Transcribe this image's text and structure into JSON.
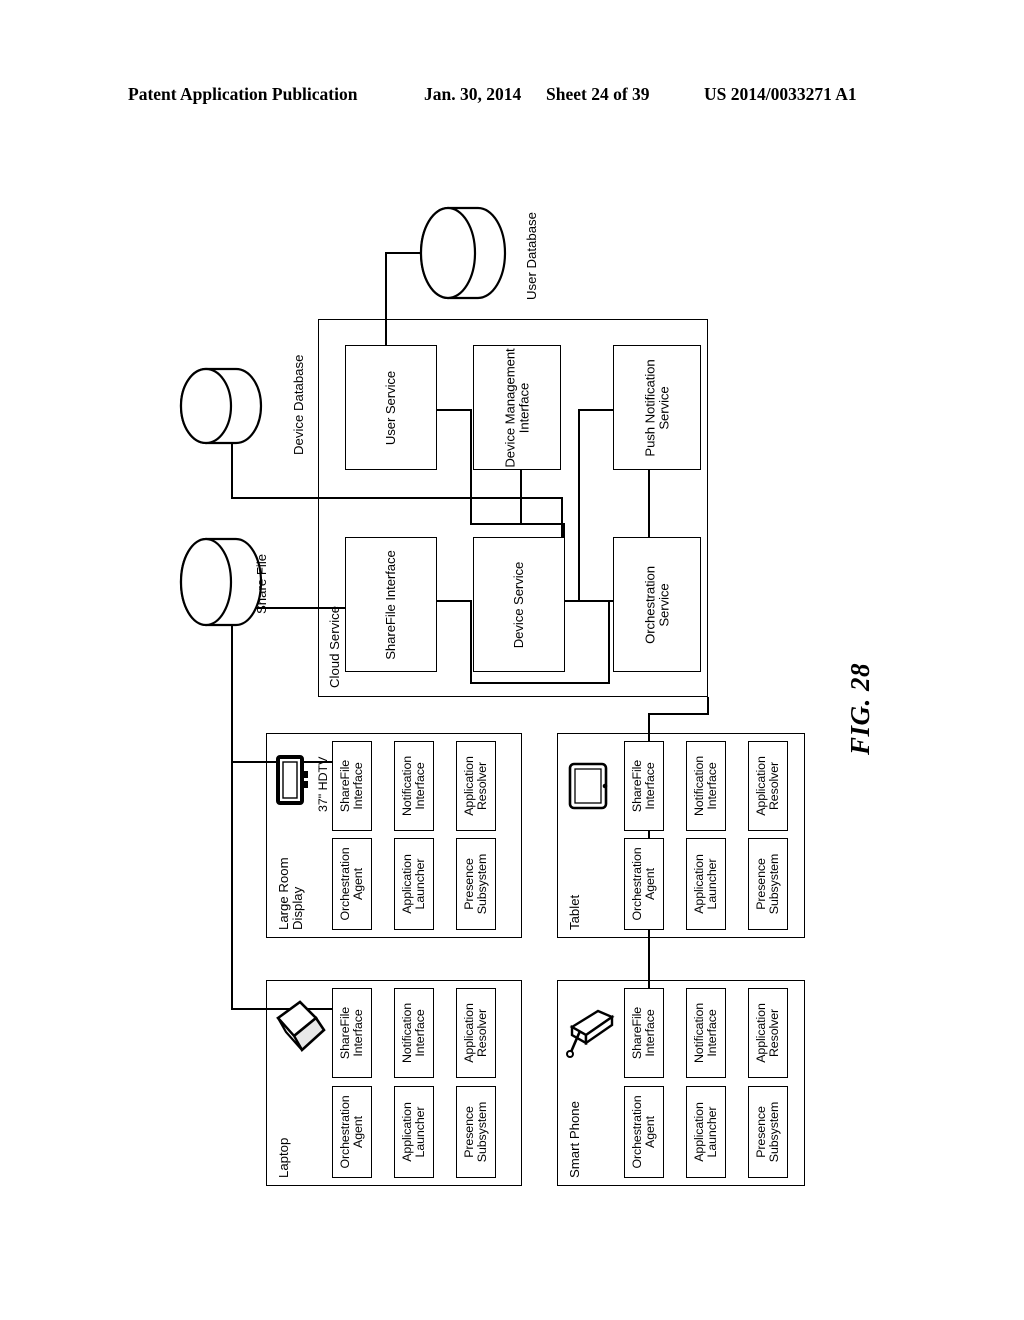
{
  "header": {
    "publication": "Patent Application Publication",
    "date": "Jan. 30, 2014",
    "sheet": "Sheet 24 of 39",
    "patent_number": "US 2014/0033271 A1"
  },
  "figure": {
    "label": "FIG. 28",
    "databases": [
      {
        "id": "user-database",
        "name": "User Database"
      },
      {
        "id": "device-database",
        "name": "Device Database"
      },
      {
        "id": "share-file",
        "name": "Share File"
      }
    ],
    "cloud_service": {
      "label": "Cloud Service",
      "services": [
        {
          "id": "user-service",
          "name": "User Service"
        },
        {
          "id": "device-management-interface",
          "name": "Device Management\nInterface"
        },
        {
          "id": "push-notification-service",
          "name": "Push Notification\nService"
        },
        {
          "id": "sharefile-interface",
          "name": "ShareFile Interface"
        },
        {
          "id": "device-service",
          "name": "Device Service"
        },
        {
          "id": "orchestration-service",
          "name": "Orchestration\nService"
        }
      ]
    },
    "devices": [
      {
        "id": "large-room-display",
        "name": "Large Room\nDisplay",
        "glyph": "hdtv-icon",
        "glyph_label": "37\" HDTV",
        "components": [
          {
            "id": "sharefile-interface",
            "name": "ShareFile\nInterface"
          },
          {
            "id": "notification-interface",
            "name": "Notification\nInterface"
          },
          {
            "id": "application-resolver",
            "name": "Application\nResolver"
          },
          {
            "id": "orchestration-agent",
            "name": "Orchestration\nAgent"
          },
          {
            "id": "application-launcher",
            "name": "Application\nLauncher"
          },
          {
            "id": "presence-subsystem",
            "name": "Presence\nSubsystem"
          }
        ]
      },
      {
        "id": "tablet",
        "name": "Tablet",
        "glyph": "tablet-icon",
        "glyph_label": "",
        "components": [
          {
            "id": "sharefile-interface",
            "name": "ShareFile\nInterface"
          },
          {
            "id": "notification-interface",
            "name": "Notification\nInterface"
          },
          {
            "id": "application-resolver",
            "name": "Application\nResolver"
          },
          {
            "id": "orchestration-agent",
            "name": "Orchestration\nAgent"
          },
          {
            "id": "application-launcher",
            "name": "Application\nLauncher"
          },
          {
            "id": "presence-subsystem",
            "name": "Presence\nSubsystem"
          }
        ]
      },
      {
        "id": "laptop",
        "name": "Laptop",
        "glyph": "laptop-icon",
        "glyph_label": "",
        "components": [
          {
            "id": "sharefile-interface",
            "name": "ShareFile\nInterface"
          },
          {
            "id": "notification-interface",
            "name": "Notification\nInterface"
          },
          {
            "id": "application-resolver",
            "name": "Application\nResolver"
          },
          {
            "id": "orchestration-agent",
            "name": "Orchestration\nAgent"
          },
          {
            "id": "application-launcher",
            "name": "Application\nLauncher"
          },
          {
            "id": "presence-subsystem",
            "name": "Presence\nSubsystem"
          }
        ]
      },
      {
        "id": "smart-phone",
        "name": "Smart Phone",
        "glyph": "smartphone-icon",
        "glyph_label": "",
        "components": [
          {
            "id": "sharefile-interface",
            "name": "ShareFile\nInterface"
          },
          {
            "id": "notification-interface",
            "name": "Notification\nInterface"
          },
          {
            "id": "application-resolver",
            "name": "Application\nResolver"
          },
          {
            "id": "orchestration-agent",
            "name": "Orchestration\nAgent"
          },
          {
            "id": "application-launcher",
            "name": "Application\nLauncher"
          },
          {
            "id": "presence-subsystem",
            "name": "Presence\nSubsystem"
          }
        ]
      }
    ]
  }
}
